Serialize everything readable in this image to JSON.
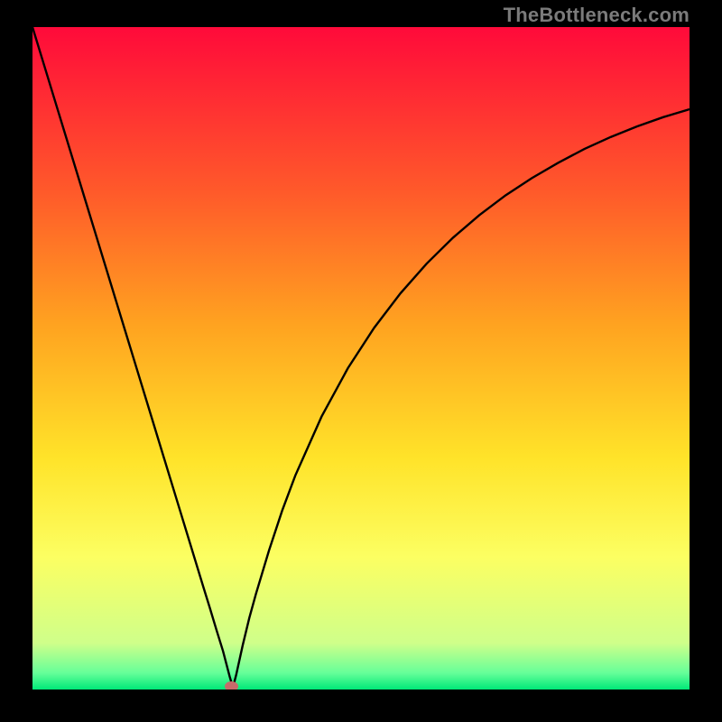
{
  "watermark_text": "TheBottleneck.com",
  "chart_data": {
    "type": "line",
    "title": "",
    "xlabel": "",
    "ylabel": "",
    "xlim": [
      0,
      100
    ],
    "ylim": [
      0,
      100
    ],
    "grid": false,
    "legend": false,
    "annotations": [],
    "background": {
      "type": "vertical-gradient",
      "stops": [
        {
          "pos": 0.0,
          "color": "#ff0a3a"
        },
        {
          "pos": 0.25,
          "color": "#ff5a2a"
        },
        {
          "pos": 0.45,
          "color": "#ffa320"
        },
        {
          "pos": 0.65,
          "color": "#ffe329"
        },
        {
          "pos": 0.8,
          "color": "#fcff62"
        },
        {
          "pos": 0.93,
          "color": "#cfff8a"
        },
        {
          "pos": 0.975,
          "color": "#66ff99"
        },
        {
          "pos": 1.0,
          "color": "#00e878"
        }
      ]
    },
    "marker": {
      "x": 30.3,
      "y": 0.5,
      "color": "#c76a6a"
    },
    "series": [
      {
        "name": "curve",
        "color": "#000000",
        "x": [
          0,
          2,
          4,
          6,
          8,
          10,
          12,
          14,
          16,
          18,
          20,
          22,
          24,
          26,
          27,
          28,
          29,
          30,
          30.5,
          31,
          32,
          33,
          34,
          36,
          38,
          40,
          44,
          48,
          52,
          56,
          60,
          64,
          68,
          72,
          76,
          80,
          84,
          88,
          92,
          96,
          100
        ],
        "y": [
          100,
          93.5,
          87,
          80.5,
          74,
          67.5,
          61,
          54.5,
          48,
          41.5,
          35,
          28.5,
          22,
          15.5,
          12.3,
          9,
          5.8,
          2.0,
          0.3,
          2.2,
          6.7,
          10.8,
          14.4,
          21.0,
          27.0,
          32.3,
          41.2,
          48.5,
          54.6,
          59.8,
          64.3,
          68.2,
          71.6,
          74.6,
          77.2,
          79.5,
          81.6,
          83.4,
          85.0,
          86.4,
          87.6
        ]
      }
    ]
  }
}
